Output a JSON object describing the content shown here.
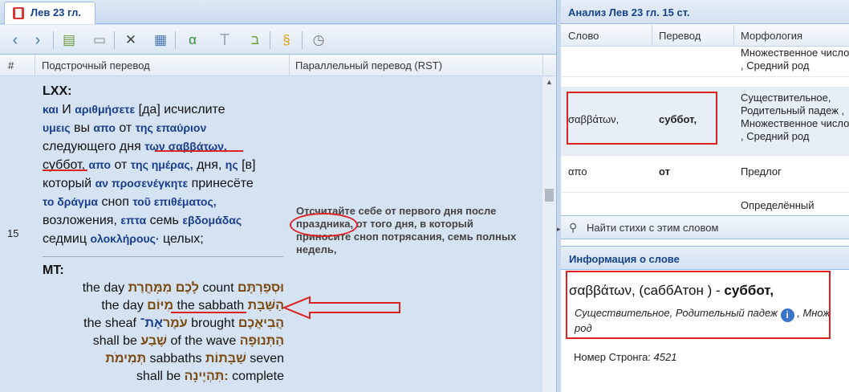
{
  "tab": {
    "label": "Лев 23 гл."
  },
  "toolbar": {
    "icons": [
      "back-arrow-icon",
      "forward-arrow-icon",
      "add-book-icon",
      "page-icon",
      "compare-icon",
      "table-icon",
      "greek-alpha-icon",
      "text-T-icon",
      "hebrew-letter-icon",
      "scroll-icon",
      "clock-icon"
    ]
  },
  "grid": {
    "col_num": "#",
    "col_interlinear": "Подстрочный перевод",
    "col_parallel": "Параллельный перевод (RST)",
    "row_number": "15"
  },
  "lxx": {
    "header": "LXX:",
    "lines": [
      [
        {
          "g": "και"
        },
        {
          "t": " И "
        },
        {
          "g": "αριθμήσετε"
        },
        {
          "t": " [да] исчислите"
        }
      ],
      [
        {
          "g": "υμεις"
        },
        {
          "t": " вы "
        },
        {
          "g": "απο"
        },
        {
          "t": " от "
        },
        {
          "g": "της επαύριον"
        }
      ],
      [
        {
          "t": "следующего дня "
        },
        {
          "g": "των σαββάτων,"
        }
      ],
      [
        {
          "t": "суббот,"
        },
        {
          "t": " "
        },
        {
          "g": "απο"
        },
        {
          "t": " от "
        },
        {
          "g": "της ημέρας,"
        },
        {
          "t": " дня, "
        },
        {
          "g": "ης"
        },
        {
          "t": " [в]"
        }
      ],
      [
        {
          "t": "который "
        },
        {
          "g": "αν προσενέγκητε"
        },
        {
          "t": " принесёте"
        }
      ],
      [
        {
          "g": "το δράγμα"
        },
        {
          "t": " сноп "
        },
        {
          "g": "τοῦ επιθέματος,"
        }
      ],
      [
        {
          "t": "возложения, "
        },
        {
          "g": "επτα"
        },
        {
          "t": " семь "
        },
        {
          "g": "εβδομάδας"
        }
      ],
      [
        {
          "t": "седмиц "
        },
        {
          "g": "ολοκλήρους·"
        },
        {
          "t": " целых;"
        }
      ]
    ]
  },
  "mt": {
    "header": "MT:",
    "lines": [
      [
        {
          "t": "the day "
        },
        {
          "h": "לָכֶם מִמָּחֳרַת"
        },
        {
          "t": " count "
        },
        {
          "h": "וּסְפַרְתֶּם"
        }
      ],
      [
        {
          "t": "the day "
        },
        {
          "h": "מִיּוֹם"
        },
        {
          "t": " the sabbath "
        },
        {
          "h": "הַשַּׁבָּת"
        }
      ],
      [
        {
          "t": "the sheaf "
        },
        {
          "h": "עֹמֶר"
        },
        {
          "b": "אֶת־"
        },
        {
          "t": " brought "
        },
        {
          "h": "הֲבִיאֲכֶם"
        }
      ],
      [
        {
          "t": "shall be "
        },
        {
          "h": "שֶׁבַע"
        },
        {
          "t": " of the wave "
        },
        {
          "h": "הַתְּנוּפָה"
        }
      ],
      [
        {
          "h": "תְּמִימֹת"
        },
        {
          "t": " sabbaths "
        },
        {
          "h": "שַׁבָּתוֹת"
        },
        {
          "t": " seven"
        }
      ],
      [
        {
          "t": "shall be "
        },
        {
          "h": "תִּהְיֶינָה:"
        },
        {
          "t": " complete"
        }
      ]
    ]
  },
  "rst": {
    "text": "Отсчитайте себе от первого дня после праздника, от того дня, в который приносите сноп потрясания, семь полных недель,"
  },
  "analysis": {
    "title": "Анализ Лев 23 гл. 15 ст.",
    "col_word": "Слово",
    "col_translation": "Перевод",
    "col_morph": "Морфология",
    "rows": [
      {
        "word": "",
        "translation": "",
        "morph": "Множественное число , Средний род"
      },
      {
        "word": "σαββάτων,",
        "translation": "суббот,",
        "morph": "Существительное, Родительный падеж , Множественное число , Средний род"
      },
      {
        "word": "απο",
        "translation": "от",
        "morph": "Предлог"
      },
      {
        "word": "",
        "translation": "",
        "morph": "Определённый"
      }
    ],
    "find_button": "Найти стихи с этим словом"
  },
  "word_info": {
    "title": "Информация о слове",
    "word": "σαββάτων,",
    "translit": " (саббАтон ) - ",
    "translation": "суббот,",
    "morph_a": "Существительное, Родительный падеж ",
    "morph_b": " , Множ",
    "morph_c": "род",
    "strong_label": "Номер Стронга: ",
    "strong_value": "4521"
  },
  "colors": {
    "accent": "#15428b",
    "greek": "#1a3e8e",
    "hebrew": "#7a4a10",
    "highlight": "#dd2222",
    "panel": "#d4e2f2"
  }
}
